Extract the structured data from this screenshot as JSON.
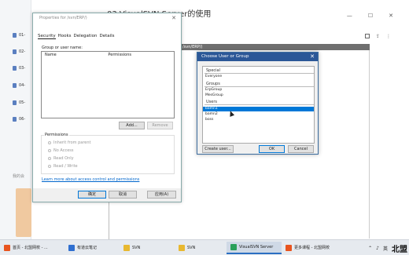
{
  "background_app": {
    "doc_title": "03.VisualSVN Server的使用",
    "sidebar_items": [
      "01-",
      "02-",
      "03-",
      "04-",
      "05-",
      "06-"
    ],
    "sidebar_label": "我的会",
    "toolbar_icons": [
      "checkbox-icon",
      "share-icon",
      "more-icon"
    ]
  },
  "svn_window": {
    "path": "/svn/ERP/)"
  },
  "properties_dialog": {
    "title": "Properties for /svn/ERP/)",
    "tabs": [
      "Security",
      "Hooks",
      "Delegation",
      "Details"
    ],
    "group_label": "Group or user name:",
    "columns": [
      "Name",
      "Permissions"
    ],
    "add_button": "Add...",
    "remove_button": "Remove",
    "permissions_label": "Permissions",
    "options": [
      "Inherit from parent",
      "No Access",
      "Read Only",
      "Read / Write"
    ],
    "learn_link": "Learn more about access control and permissions",
    "ok_button": "确定",
    "cancel_button": "取消",
    "apply_button": "应用(A)"
  },
  "choose_dialog": {
    "title": "Choose User or Group",
    "sections": {
      "special": "Special",
      "groups": "Groups",
      "users": "Users"
    },
    "special_items": [
      "Everyone"
    ],
    "group_items": [
      "ErpGroup",
      "MesGroup"
    ],
    "user_items": [
      "bamn1",
      "bamn2",
      "boss"
    ],
    "selected": "bamn1",
    "create_button": "Create user...",
    "ok_button": "OK",
    "cancel_button": "Cancel"
  },
  "taskbar": {
    "apps": [
      {
        "label": "首页 - 北盟网校 - ...",
        "icon": "browser-icon",
        "color": "#e8541e"
      },
      {
        "label": "有道云笔记",
        "icon": "note-icon",
        "color": "#2f6fd0"
      },
      {
        "label": "SVN",
        "icon": "folder-icon",
        "color": "#e8b830"
      },
      {
        "label": "SVN",
        "icon": "folder-icon",
        "color": "#e8b830"
      },
      {
        "label": "VisualSVN Server",
        "icon": "svn-icon",
        "color": "#2aa05a"
      },
      {
        "label": "更多课程 - 北盟网校",
        "icon": "browser-icon",
        "color": "#e8541e"
      }
    ],
    "ime": "英",
    "watermark": "北盟"
  }
}
